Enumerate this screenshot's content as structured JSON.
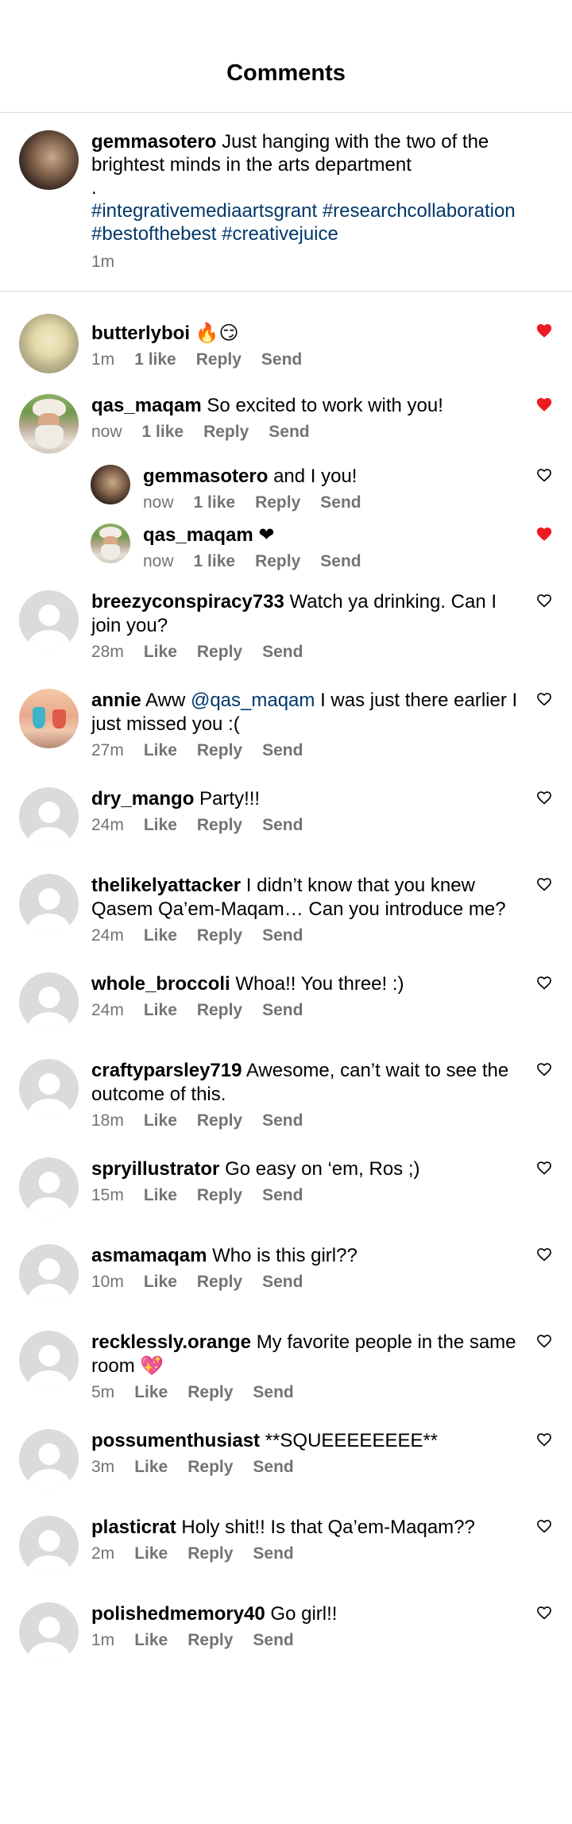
{
  "header": {
    "title": "Comments"
  },
  "caption": {
    "username": "gemmasotero",
    "text": "Just hanging with the two of the brightest minds in the arts department",
    "dot": ".",
    "tags": "#integrativemediaartsgrant #researchcollaboration #bestofthebest #creativejuice",
    "time": "1m"
  },
  "comments": [
    {
      "username": "butterlyboi",
      "text": "🔥😏",
      "time": "1m",
      "like": "1 like",
      "reply": "Reply",
      "send": "Send",
      "liked": true
    },
    {
      "username": "qas_maqam",
      "text": "So excited to work with you!",
      "time": "now",
      "like": "1 like",
      "reply": "Reply",
      "send": "Send",
      "liked": true
    },
    {
      "username": "gemmasotero",
      "text": "and I you!",
      "time": "now",
      "like": "1 like",
      "reply": "Reply",
      "send": "Send",
      "liked": false
    },
    {
      "username": "qas_maqam",
      "text": "❤",
      "time": "now",
      "like": "1 like",
      "reply": "Reply",
      "send": "Send",
      "liked": true
    },
    {
      "username": "breezyconspiracy733",
      "text": "Watch ya drinking. Can I join you?",
      "time": "28m",
      "like": "Like",
      "reply": "Reply",
      "send": "Send",
      "liked": false
    },
    {
      "username": "annie",
      "text_pre": "Aww",
      "mention": "@qas_maqam",
      "text_post": "I was just there earlier I just missed you :(",
      "time": "27m",
      "like": "Like",
      "reply": "Reply",
      "send": "Send",
      "liked": false
    },
    {
      "username": "dry_mango",
      "text": "Party!!!",
      "time": "24m",
      "like": "Like",
      "reply": "Reply",
      "send": "Send",
      "liked": false
    },
    {
      "username": "thelikelyattacker",
      "text": "I didn’t know that you knew Qasem Qa’em-Maqam… Can you introduce me?",
      "time": "24m",
      "like": "Like",
      "reply": "Reply",
      "send": "Send",
      "liked": false
    },
    {
      "username": "whole_broccoli",
      "text": "Whoa!! You three! :)",
      "time": "24m",
      "like": "Like",
      "reply": "Reply",
      "send": "Send",
      "liked": false
    },
    {
      "username": "craftyparsley719",
      "text": "Awesome, can’t wait to see the outcome of this.",
      "time": "18m",
      "like": "Like",
      "reply": "Reply",
      "send": "Send",
      "liked": false
    },
    {
      "username": "spryillustrator",
      "text": "Go easy on ‘em, Ros ;)",
      "time": "15m",
      "like": "Like",
      "reply": "Reply",
      "send": "Send",
      "liked": false
    },
    {
      "username": "asmamaqam",
      "text": "Who is this girl??",
      "time": "10m",
      "like": "Like",
      "reply": "Reply",
      "send": "Send",
      "liked": false
    },
    {
      "username": "recklessly.orange",
      "text": "My favorite people in the same room 💖",
      "time": "5m",
      "like": "Like",
      "reply": "Reply",
      "send": "Send",
      "liked": false
    },
    {
      "username": "possumenthusiast",
      "text": "**SQUEEEEEEEE**",
      "time": "3m",
      "like": "Like",
      "reply": "Reply",
      "send": "Send",
      "liked": false
    },
    {
      "username": "plasticrat",
      "text": "Holy shit!! Is that Qa’em-Maqam??",
      "time": "2m",
      "like": "Like",
      "reply": "Reply",
      "send": "Send",
      "liked": false
    },
    {
      "username": "polishedmemory40",
      "text": "Go girl!!",
      "time": "1m",
      "like": "Like",
      "reply": "Reply",
      "send": "Send",
      "liked": false
    }
  ],
  "colors": {
    "liked_heart": "#ed1c24",
    "link": "#00376b",
    "muted": "#737373"
  }
}
